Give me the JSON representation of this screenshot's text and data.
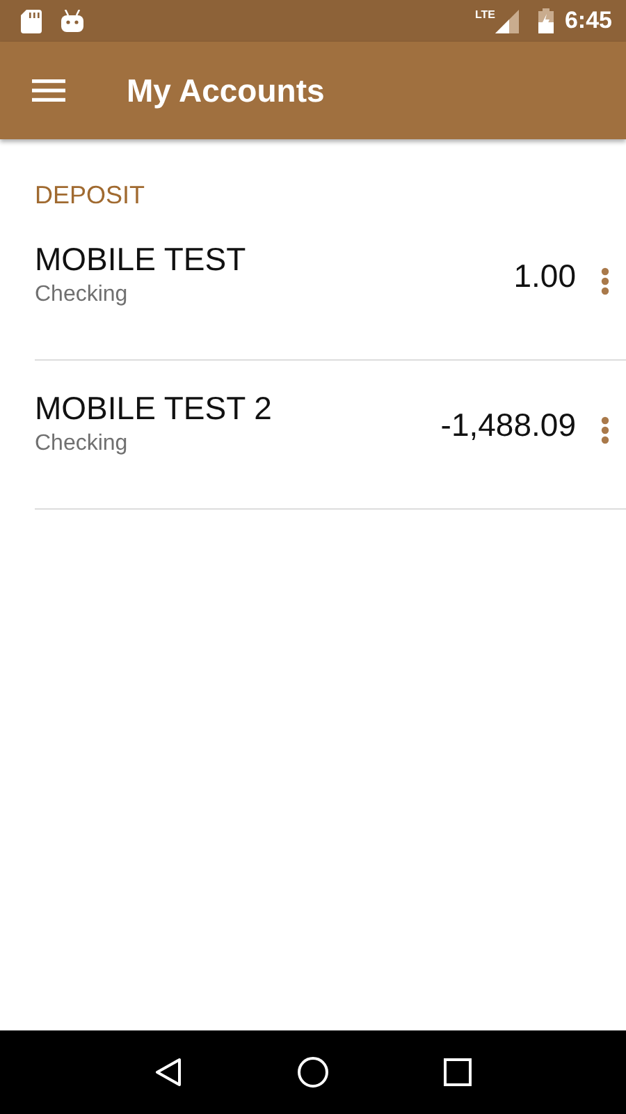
{
  "status_bar": {
    "network": "LTE",
    "time": "6:45"
  },
  "toolbar": {
    "title": "My Accounts"
  },
  "section": {
    "title": "DEPOSIT"
  },
  "accounts": [
    {
      "name": "MOBILE TEST",
      "type": "Checking",
      "balance": "1.00"
    },
    {
      "name": "MOBILE TEST 2",
      "type": "Checking",
      "balance": "-1,488.09"
    }
  ]
}
